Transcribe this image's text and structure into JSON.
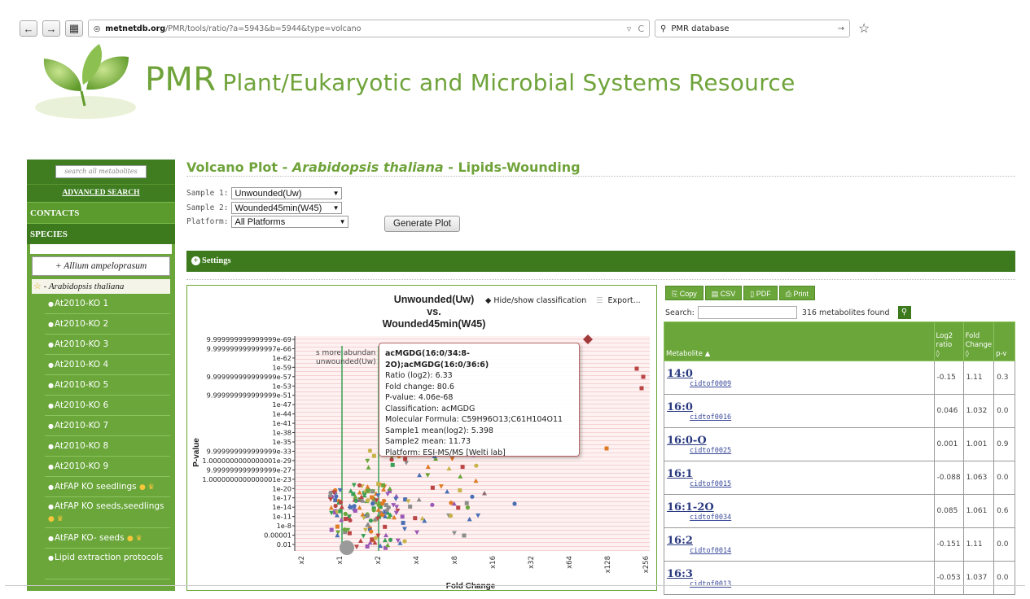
{
  "browser": {
    "back": "←",
    "forward": "→",
    "url_domain": "metnetdb.org",
    "url_path": "/PMR/tools/ratio/?a=5943&b=5944&type=volcano",
    "search_value": "PMR database"
  },
  "header": {
    "acronym": "PMR",
    "title": "Plant/Eukaryotic and Microbial Systems Resource"
  },
  "sidebar": {
    "search_placeholder": "search all metabolites",
    "advanced_search": "ADVANCED SEARCH",
    "contacts": "CONTACTS",
    "species": "SPECIES",
    "allium": "+ Allium ampeloprasum",
    "arabidopsis": "- Arabidopsis thaliana",
    "items": [
      {
        "label": "At2010-KO 1"
      },
      {
        "label": "At2010-KO 2"
      },
      {
        "label": "At2010-KO 3"
      },
      {
        "label": "At2010-KO 4"
      },
      {
        "label": "At2010-KO 5"
      },
      {
        "label": "At2010-KO 6"
      },
      {
        "label": "At2010-KO 7"
      },
      {
        "label": "At2010-KO 8"
      },
      {
        "label": "At2010-KO 9"
      },
      {
        "label": "AtFAP KO seedlings"
      },
      {
        "label": "AtFAP KO seeds,seedlings"
      },
      {
        "label": "AtFAP KO- seeds"
      },
      {
        "label": "Lipid extraction protocols"
      }
    ]
  },
  "main": {
    "title_prefix": "Volcano Plot - ",
    "title_species": "Arabidopsis thaliana",
    "title_suffix": " - Lipids-Wounding",
    "sample1_label": "Sample 1:",
    "sample1_value": "Unwounded(Uw)",
    "sample2_label": "Sample 2:",
    "sample2_value": "Wounded45min(W45)",
    "platform_label": "Platform:",
    "platform_value": "All Platforms",
    "generate": "Generate Plot",
    "settings": "Settings"
  },
  "plot": {
    "title_line1": "Unwounded(Uw)",
    "title_line2": "vs.",
    "title_line3": "Wounded45min(W45)",
    "hide_show": "Hide/show classification",
    "export": "Export...",
    "ylabel": "P-value",
    "xlabel": "Fold Change",
    "legend_text1": "s more abundan",
    "legend_text2": "unwounded(Uw)",
    "yticks": [
      "9.999999999999999e-69",
      "9.999999999999997e-66",
      "1e-62",
      "1e-59",
      "9.999999999999999e-57",
      "1e-53",
      "9.999999999999999e-51",
      "1e-47",
      "1e-44",
      "1e-41",
      "1e-38",
      "1e-35",
      "9.999999999999999e-33",
      "1.0000000000000001e-29",
      "9.999999999999999e-27",
      "1.0000000000000001e-23",
      "1e-20",
      "1e-17",
      "1e-14",
      "1e-11",
      "1e-8",
      "0.00001",
      "0.01"
    ],
    "xticks": [
      "x2",
      "x1",
      "x2",
      "x4",
      "x8",
      "x16",
      "x32",
      "x64",
      "x128",
      "x256"
    ],
    "tooltip": {
      "head": "acMGDG(16:0/34:8-2O);acMGDG(16:0/36:6)",
      "lines": [
        "Ratio (log2): 6.33",
        "Fold change: 80.6",
        "P-value: 4.06e-68",
        "Classification: acMGDG",
        "Molecular Formula: C59H96O13;C61H104O11",
        "Sample1 mean(log2): 5.398",
        "Sample2 mean: 11.73",
        "Platform: ESI-MS/MS [Welti lab]"
      ]
    }
  },
  "table": {
    "buttons": [
      "Copy",
      "CSV",
      "PDF",
      "Print"
    ],
    "search_label": "Search:",
    "found": "316 metabolites found",
    "headers": [
      "Metabolite",
      "Log2 ratio",
      "Fold Change",
      "p-v"
    ],
    "rows": [
      {
        "name": "14:0",
        "id": "cidtof0009",
        "log2": "-0.15",
        "fold": "1.11",
        "p": "0.3"
      },
      {
        "name": "16:0",
        "id": "cidtof0016",
        "log2": "0.046",
        "fold": "1.032",
        "p": "0.0"
      },
      {
        "name": "16:0-O",
        "id": "cidtof0025",
        "log2": "0.001",
        "fold": "1.001",
        "p": "0.9"
      },
      {
        "name": "16:1",
        "id": "cidtof0015",
        "log2": "-0.088",
        "fold": "1.063",
        "p": "0.0"
      },
      {
        "name": "16:1-2O",
        "id": "cidtof0034",
        "log2": "0.085",
        "fold": "1.061",
        "p": "0.6"
      },
      {
        "name": "16:2",
        "id": "cidtof0014",
        "log2": "-0.151",
        "fold": "1.11",
        "p": "0.0"
      },
      {
        "name": "16:3",
        "id": "cidtof0013",
        "log2": "-0.053",
        "fold": "1.037",
        "p": "0.0"
      }
    ]
  },
  "colors": {
    "brand_green": "#6fa33a",
    "sidebar_green": "#6aa63a",
    "dark_green": "#3d7a1e",
    "link_blue": "#2a3a80"
  }
}
